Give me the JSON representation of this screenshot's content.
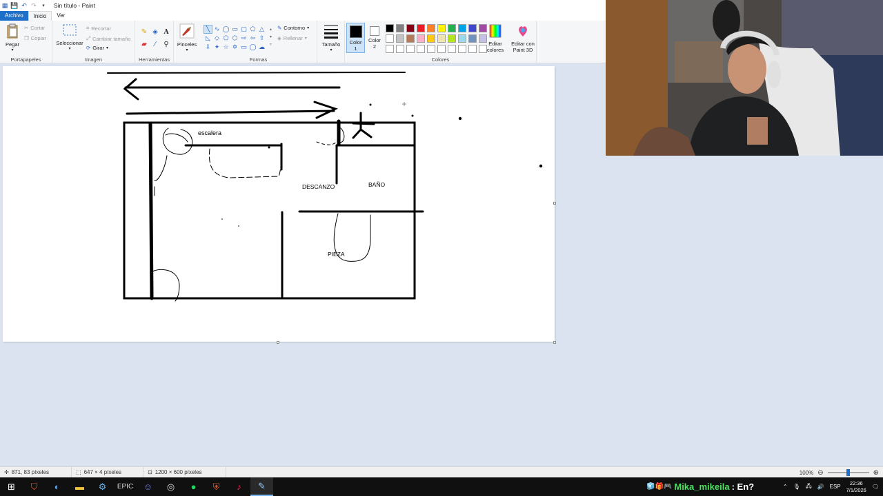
{
  "window": {
    "title": "Sin título - Paint"
  },
  "menu_tabs": [
    "Archivo",
    "Inicio",
    "Ver"
  ],
  "ribbon": {
    "clipboard": {
      "paste": "Pegar",
      "cut": "Cortar",
      "copy": "Copiar",
      "group": "Portapapeles"
    },
    "image": {
      "select": "Seleccionar",
      "crop": "Recortar",
      "resize": "Cambiar tamaño",
      "rotate": "Girar",
      "group": "Imagen"
    },
    "tools": {
      "group": "Herramientas"
    },
    "brushes": {
      "label": "Pinceles"
    },
    "shapes": {
      "outline": "Contorno",
      "fill": "Rellenar",
      "group": "Formas"
    },
    "size": {
      "label": "Tamaño"
    },
    "colors": {
      "color1": "Color",
      "color1_num": "1",
      "color2": "Color",
      "color2_num": "2",
      "edit_colors": "Editar colores",
      "paint3d": "Editar con Paint 3D",
      "group": "Colores",
      "color1_value": "#000000",
      "color2_value": "#ffffff",
      "palette": [
        "#000000",
        "#7f7f7f",
        "#880015",
        "#ed1c24",
        "#ff7f27",
        "#fff200",
        "#22b14c",
        "#00a2e8",
        "#3f48cc",
        "#a349a4",
        "#ffffff",
        "#c3c3c3",
        "#b97a57",
        "#ffaec9",
        "#ffc90e",
        "#efe4b0",
        "#b5e61d",
        "#99d9ea",
        "#7092be",
        "#c8bfe7",
        "#ffffff",
        "#ffffff",
        "#ffffff",
        "#ffffff",
        "#ffffff",
        "#ffffff",
        "#ffffff",
        "#ffffff",
        "#ffffff",
        "#ffffff"
      ]
    }
  },
  "canvas": {
    "labels": {
      "stairs": "escalera",
      "landing": "DESCANZO",
      "bathroom": "BAÑO",
      "room": "PIEZA"
    }
  },
  "status": {
    "cursor": "871, 83 píxeles",
    "selection": "647 × 4 píxeles",
    "image_size": "1200 × 600 píxeles",
    "zoom": "100%",
    "zoom_level": 1.0
  },
  "taskbar": {
    "apps": [
      "windows-icon",
      "brave-shield-icon",
      "copilot-icon",
      "file-explorer-icon",
      "steam-icon",
      "epic-games-icon",
      "discord-icon",
      "obs-icon",
      "spotify-icon",
      "brave-icon",
      "tiktok-icon",
      "paint-icon"
    ],
    "chat_user": "Mika_mikeila",
    "chat_message": ": En?",
    "lang": "ESP",
    "time": "22:36",
    "date": "7/1/2026"
  }
}
